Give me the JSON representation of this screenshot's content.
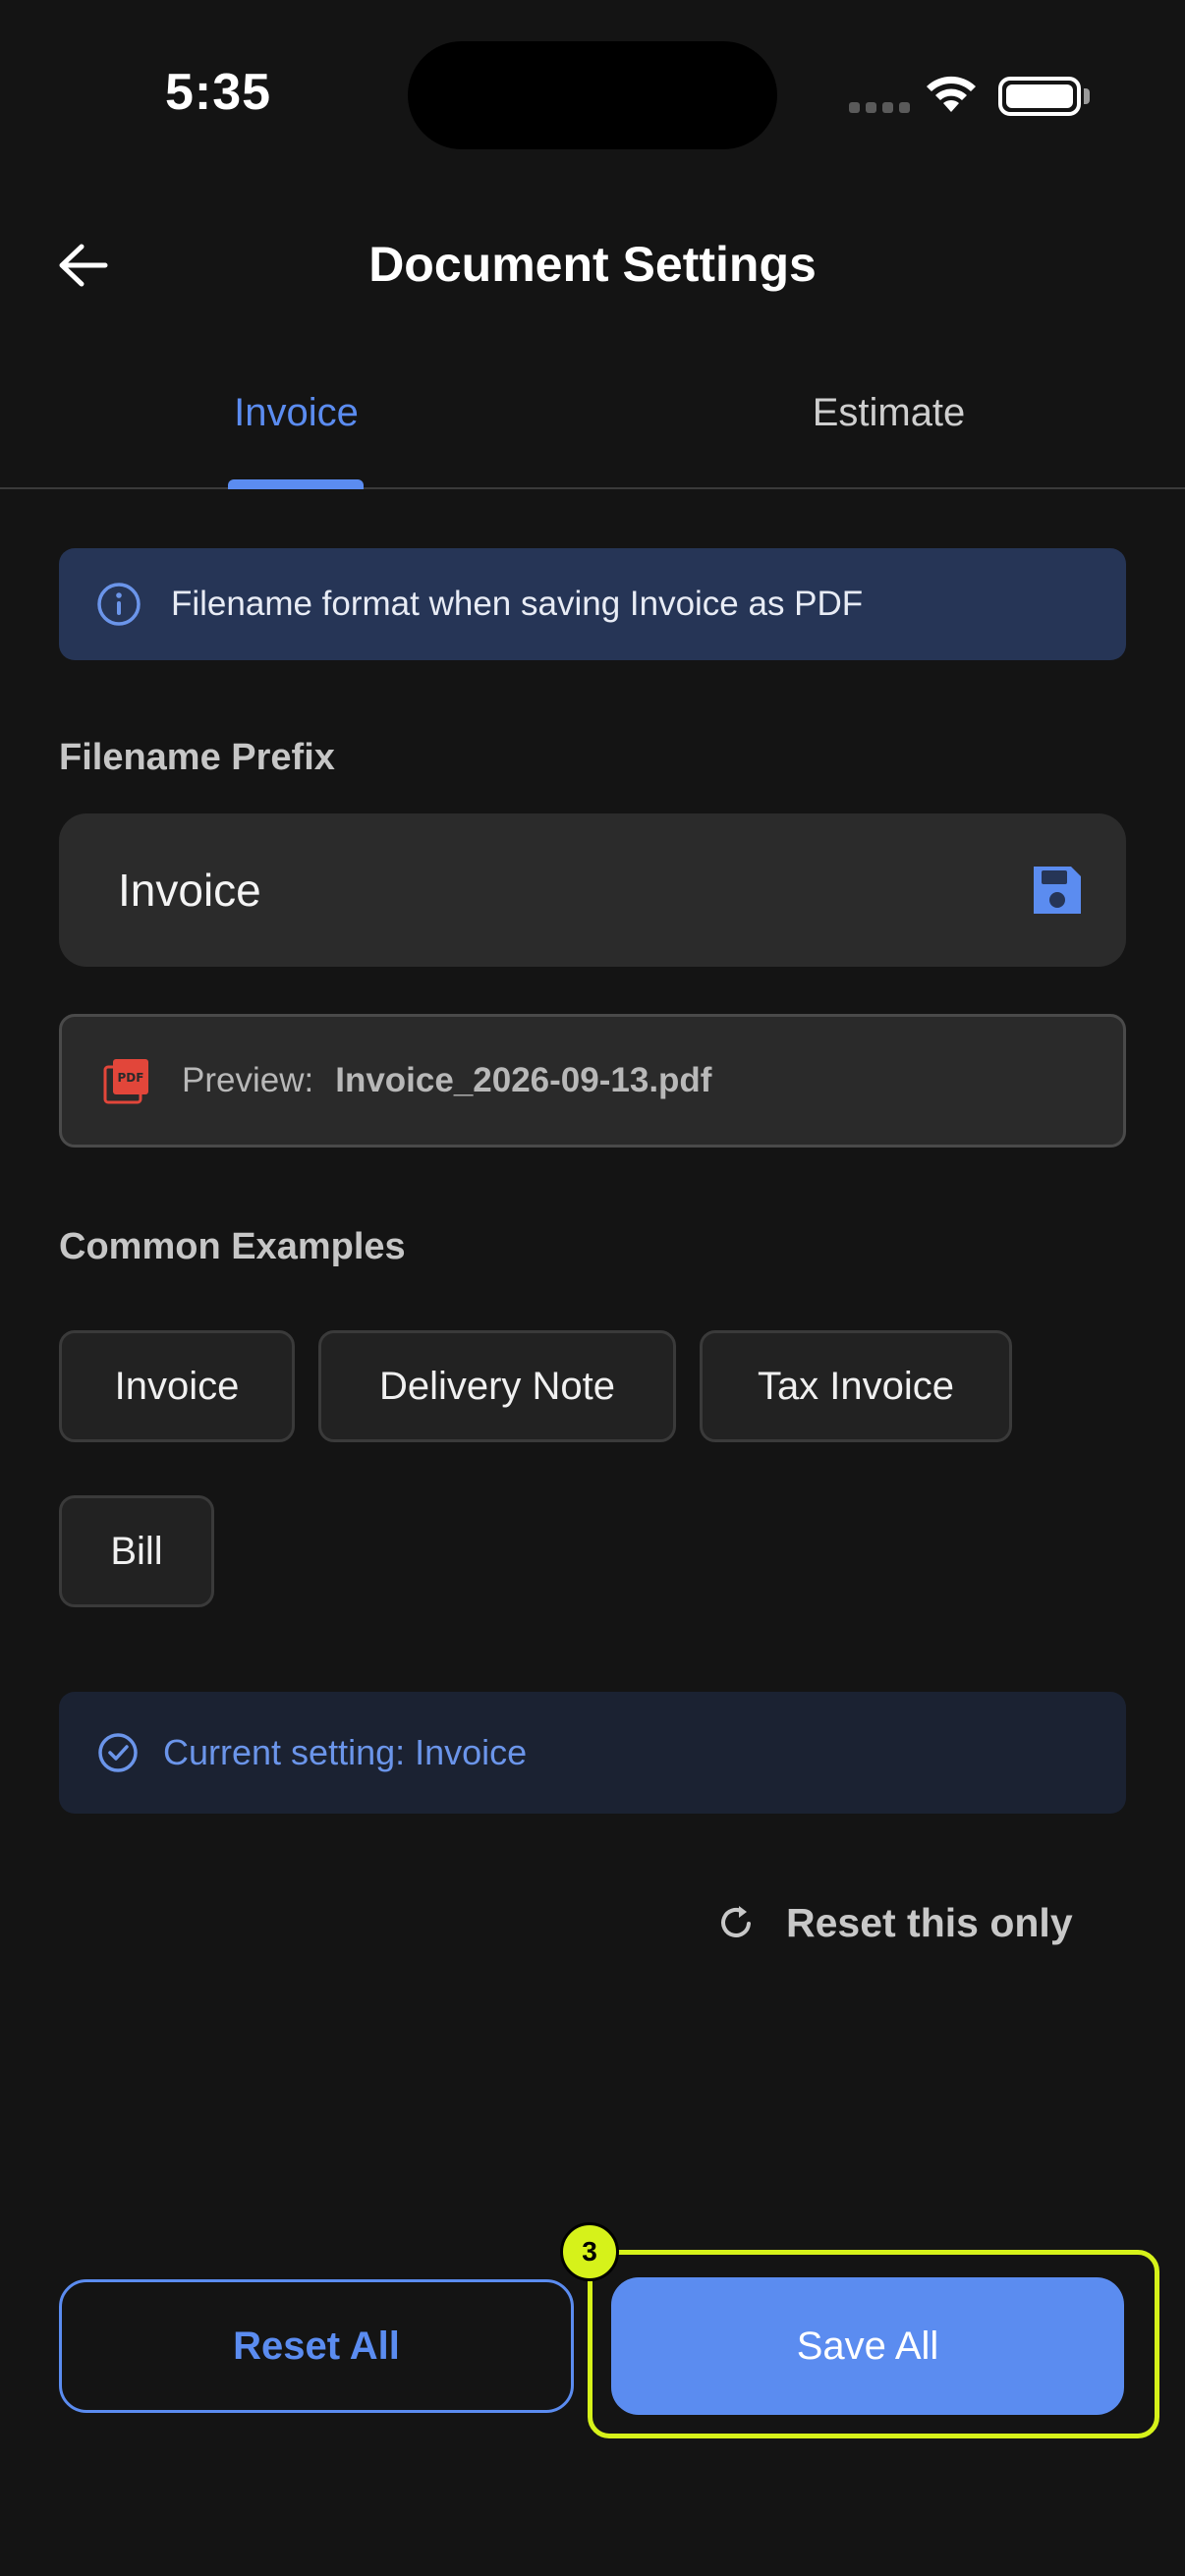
{
  "status_bar": {
    "time": "5:35"
  },
  "header": {
    "title": "Document Settings"
  },
  "tabs": [
    {
      "label": "Invoice",
      "active": true
    },
    {
      "label": "Estimate",
      "active": false
    }
  ],
  "info_banner": {
    "text": "Filename format when saving Invoice as PDF"
  },
  "filename_prefix": {
    "label": "Filename Prefix",
    "value": "Invoice"
  },
  "preview": {
    "label": "Preview:",
    "filename": "Invoice_2026-09-13.pdf"
  },
  "common_examples": {
    "label": "Common Examples",
    "items": [
      "Invoice",
      "Delivery Note",
      "Tax Invoice",
      "Bill"
    ]
  },
  "current_setting": {
    "text": "Current setting: Invoice"
  },
  "reset_this_only": {
    "label": "Reset this only"
  },
  "buttons": {
    "reset_all": "Reset All",
    "save_all": "Save All"
  },
  "annotation": {
    "badge_number": "3"
  },
  "colors": {
    "accent": "#5b8cf0",
    "background": "#141414",
    "highlight": "#d6f21a",
    "pdf_icon": "#e2463a"
  },
  "icons": [
    "back-arrow-icon",
    "info-icon",
    "save-icon",
    "pdf-icon",
    "check-circle-icon",
    "refresh-icon",
    "wifi-icon",
    "battery-icon",
    "signal-icon"
  ]
}
